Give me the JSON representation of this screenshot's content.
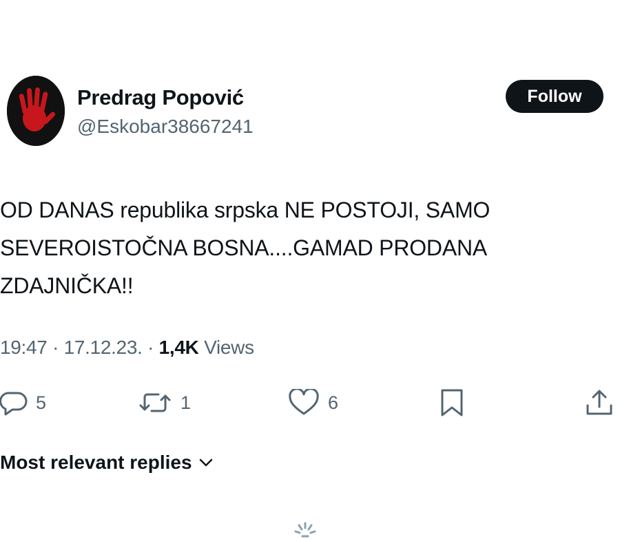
{
  "profile": {
    "display_name": "Predrag Popović",
    "handle": "@Eskobar38667241",
    "avatar_icon": "red-handprint-icon"
  },
  "follow_button": {
    "label": "Follow"
  },
  "tweet": {
    "lines": [
      "OD DANAS republika srpska NE POSTOJI, SAMO",
      "SEVEROISTOČNA BOSNA....GAMAD PRODANA",
      "ZDAJNIČKA!!"
    ],
    "time": "19:47",
    "date": "17.12.23.",
    "views_count": "1,4K",
    "views_label": "Views"
  },
  "actions": {
    "reply": {
      "icon": "reply-icon",
      "count": "5"
    },
    "retweet": {
      "icon": "retweet-icon",
      "count": "1"
    },
    "like": {
      "icon": "heart-icon",
      "count": "6"
    },
    "bookmark": {
      "icon": "bookmark-icon"
    },
    "share": {
      "icon": "share-icon"
    }
  },
  "replies_filter": {
    "label": "Most relevant replies",
    "icon": "chevron-down-icon"
  },
  "colors": {
    "text_primary": "#0f1419",
    "text_secondary": "#536471",
    "button_bg": "#0f1419",
    "avatar_accent": "#c8161d"
  }
}
